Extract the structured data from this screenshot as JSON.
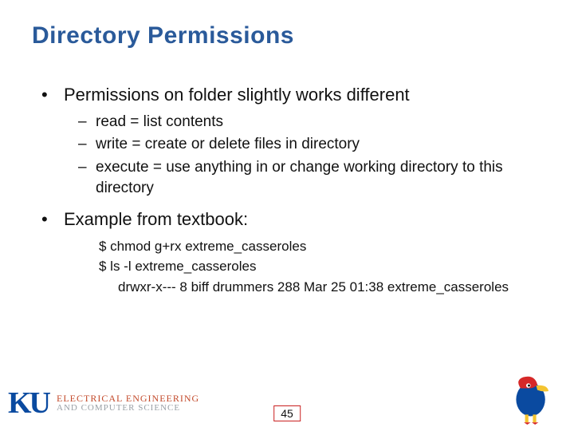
{
  "title": "Directory Permissions",
  "bullets": {
    "b1": "Permissions on folder slightly works different",
    "b1_sub": {
      "s1": "read = list contents",
      "s2": "write = create or delete files in directory",
      "s3": "execute = use anything in or change working directory to this directory"
    },
    "b2": "Example from textbook:",
    "code": {
      "l1": "$ chmod g+rx extreme_casseroles",
      "l2": "$ ls -l extreme_casseroles",
      "l3": "drwxr-x--- 8 biff drummers 288 Mar 25 01:38 extreme_casseroles"
    }
  },
  "footer": {
    "ku_mark": "KU",
    "dept_line1": "ELECTRICAL ENGINEERING",
    "dept_line2": "AND COMPUTER SCIENCE",
    "page": "45"
  }
}
